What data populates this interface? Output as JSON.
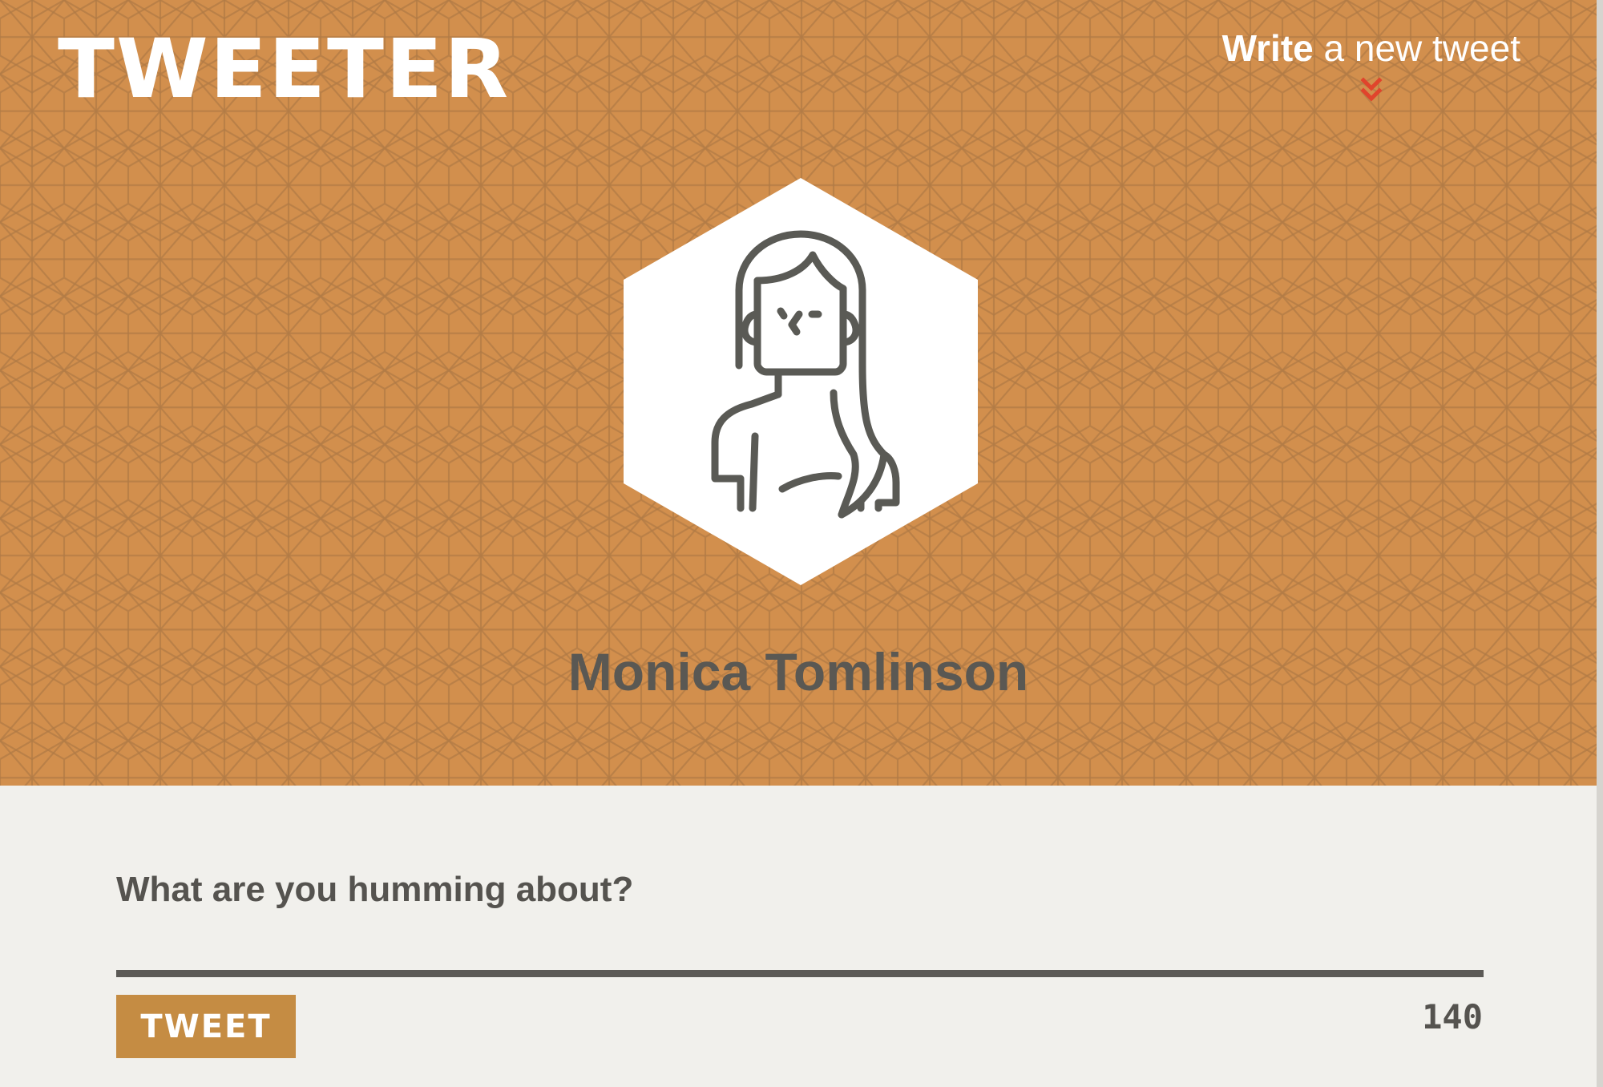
{
  "header": {
    "logo": "TWEETER",
    "write_link": {
      "strong": "Write",
      "rest": " a new tweet"
    },
    "user_name": "Monica Tomlinson"
  },
  "composer": {
    "placeholder": "What are you humming about?",
    "tweet_button": "TWEET",
    "char_count": "140"
  },
  "colors": {
    "header_bg": "#d28f4d",
    "pattern_line": "#b17a45",
    "composer_bg": "#f1f0ec",
    "button_bg": "#c58c43",
    "chevron": "#e0442c",
    "text_dark": "#55534f"
  },
  "icons": {
    "avatar": "woman-avatar-icon",
    "chevron": "double-chevron-down-icon"
  }
}
